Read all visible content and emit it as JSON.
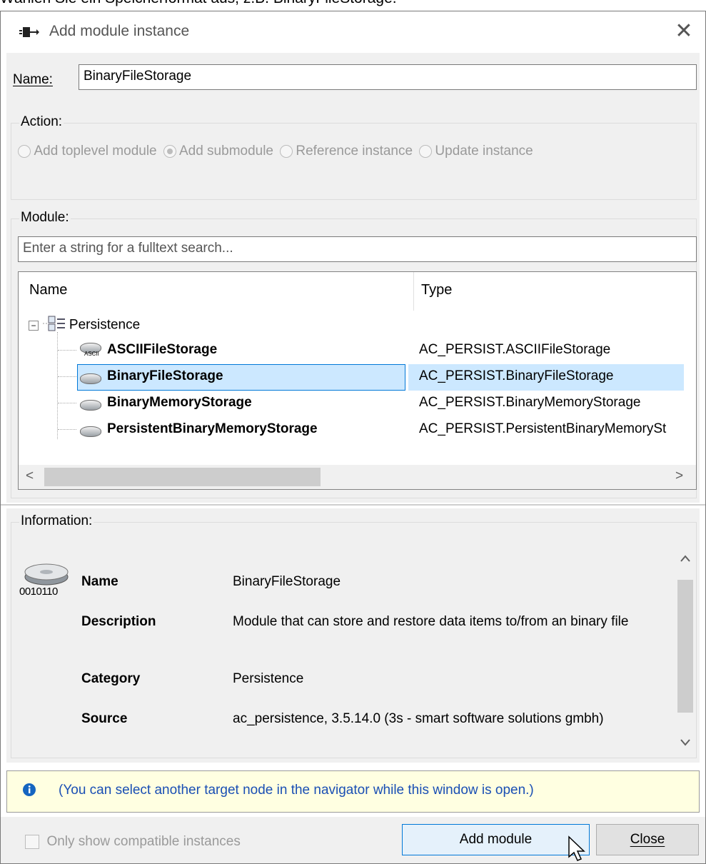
{
  "caption": "Wählen Sie ein Speicherformat aus, z.B. BinaryFileStorage.",
  "window": {
    "title": "Add module instance",
    "close_glyph": "✕"
  },
  "name_field": {
    "label": "Name:",
    "value": "BinaryFileStorage"
  },
  "action": {
    "label": "Action:",
    "options": [
      {
        "label": "Add toplevel module",
        "selected": false
      },
      {
        "label": "Add submodule",
        "selected": true
      },
      {
        "label": "Reference instance",
        "selected": false
      },
      {
        "label": "Update instance",
        "selected": false
      }
    ]
  },
  "module": {
    "label": "Module:",
    "search_placeholder": "Enter a string for a fulltext search...",
    "columns": {
      "name": "Name",
      "type": "Type"
    },
    "category": "Persistence",
    "rows": [
      {
        "name": "ASCIIFileStorage",
        "type": "AC_PERSIST.ASCIIFileStorage",
        "icon_text": "ASCII"
      },
      {
        "name": "BinaryFileStorage",
        "type": "AC_PERSIST.BinaryFileStorage",
        "selected": true
      },
      {
        "name": "BinaryMemoryStorage",
        "type": "AC_PERSIST.BinaryMemoryStorage"
      },
      {
        "name": "PersistentBinaryMemoryStorage",
        "type": "AC_PERSIST.PersistentBinaryMemorySt"
      }
    ],
    "scroll_left": "<",
    "scroll_right": ">"
  },
  "information": {
    "label": "Information:",
    "icon_text": "0010110",
    "fields": {
      "name_label": "Name",
      "name_value": "BinaryFileStorage",
      "description_label": "Description",
      "description_value": "Module that can store and restore data items to/from an binary file",
      "category_label": "Category",
      "category_value": "Persistence",
      "source_label": "Source",
      "source_value": "ac_persistence, 3.5.14.0 (3s - smart software solutions gmbh)"
    }
  },
  "notice": {
    "text": "(You can select another target node in the navigator while this window is open.)"
  },
  "footer": {
    "compatible_label": "Only show compatible instances",
    "add_button": "Add module",
    "close_button": "Close"
  },
  "colors": {
    "selection": "#cce8ff",
    "selection_border": "#0078d7",
    "notice_bg": "#ffffe1"
  }
}
